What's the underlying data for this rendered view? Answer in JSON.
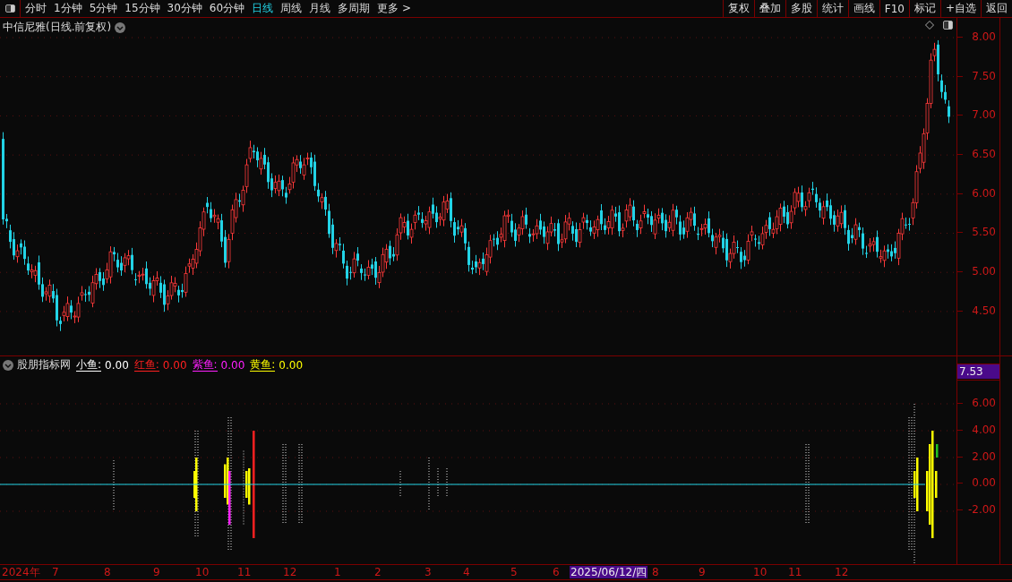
{
  "toolbar": {
    "periods": [
      {
        "label": "分时",
        "selected": false
      },
      {
        "label": "1分钟",
        "selected": false
      },
      {
        "label": "5分钟",
        "selected": false
      },
      {
        "label": "15分钟",
        "selected": false
      },
      {
        "label": "30分钟",
        "selected": false
      },
      {
        "label": "60分钟",
        "selected": false
      },
      {
        "label": "日线",
        "selected": true
      },
      {
        "label": "周线",
        "selected": false
      },
      {
        "label": "月线",
        "selected": false
      },
      {
        "label": "多周期",
        "selected": false
      },
      {
        "label": "更多 >",
        "selected": false
      }
    ],
    "buttons": [
      "复权",
      "叠加",
      "多股",
      "统计",
      "画线",
      "F10",
      "标记",
      "+自选",
      "返回"
    ]
  },
  "main_chart": {
    "title": "中信尼雅(日线.前复权)",
    "yticks": [
      "8.00",
      "7.50",
      "7.00",
      "6.50",
      "6.00",
      "5.50",
      "5.00",
      "4.50"
    ]
  },
  "indicator": {
    "name": "股朋指标网",
    "legend": [
      {
        "label": "小鱼:",
        "value": "0.00",
        "color": "#ffffff"
      },
      {
        "label": "红鱼:",
        "value": "0.00",
        "color": "#ff2020"
      },
      {
        "label": "紫鱼:",
        "value": "0.00",
        "color": "#ff20ff"
      },
      {
        "label": "黄鱼:",
        "value": "0.00",
        "color": "#ffff00"
      }
    ],
    "current_value": "7.53",
    "yticks": [
      "6.00",
      "4.00",
      "2.00",
      "0.00",
      "-2.00"
    ]
  },
  "time_axis": [
    {
      "label": "2024年",
      "selected": false
    },
    {
      "label": "7",
      "selected": false
    },
    {
      "label": "8",
      "selected": false
    },
    {
      "label": "9",
      "selected": false
    },
    {
      "label": "10",
      "selected": false
    },
    {
      "label": "11",
      "selected": false
    },
    {
      "label": "12",
      "selected": false
    },
    {
      "label": "1",
      "selected": false
    },
    {
      "label": "2",
      "selected": false
    },
    {
      "label": "3",
      "selected": false
    },
    {
      "label": "4",
      "selected": false
    },
    {
      "label": "5",
      "selected": false
    },
    {
      "label": "6",
      "selected": false
    },
    {
      "label": "2025/06/12/四",
      "selected": true
    },
    {
      "label": "8",
      "selected": false
    },
    {
      "label": "9",
      "selected": false
    },
    {
      "label": "10",
      "selected": false
    },
    {
      "label": "11",
      "selected": false
    },
    {
      "label": "12",
      "selected": false
    }
  ]
}
